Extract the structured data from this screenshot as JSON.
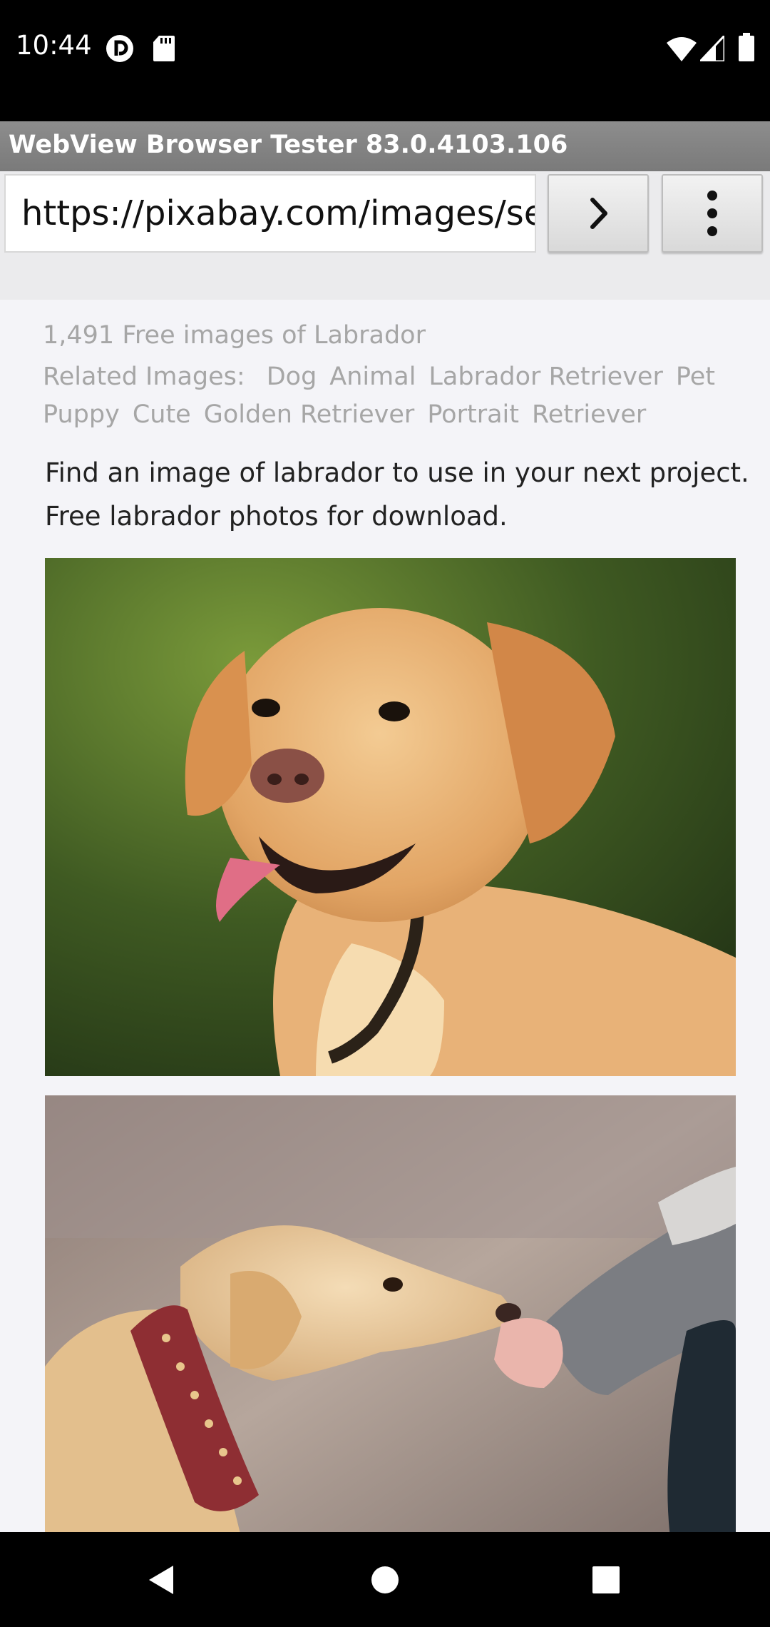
{
  "status_bar": {
    "time": "10:44",
    "left_icons": [
      "pocket-casts-icon",
      "sd-card-icon"
    ],
    "right_icons": [
      "wifi-icon",
      "cell-signal-icon",
      "battery-icon"
    ]
  },
  "app": {
    "title": "WebView Browser Tester 83.0.4103.106"
  },
  "toolbar": {
    "url_value": "https://pixabay.com/images/se",
    "go_icon": "chevron-right-icon",
    "menu_icon": "more-vert-icon"
  },
  "page": {
    "result_count": "1,491 Free images of Labrador",
    "related_label": "Related Images:",
    "related_tags": [
      "Dog",
      "Animal",
      "Labrador Retriever",
      "Pet",
      "Puppy",
      "Cute",
      "Golden Retriever",
      "Portrait",
      "Retriever"
    ],
    "description": "Find an image of labrador to use in your next project. Free labrador photos for download.",
    "photos": [
      {
        "subject": "labrador-portrait-photo"
      },
      {
        "subject": "labrador-hand-photo"
      }
    ]
  },
  "nav_bar": {
    "buttons": [
      "back-icon",
      "home-icon",
      "recents-icon"
    ]
  }
}
